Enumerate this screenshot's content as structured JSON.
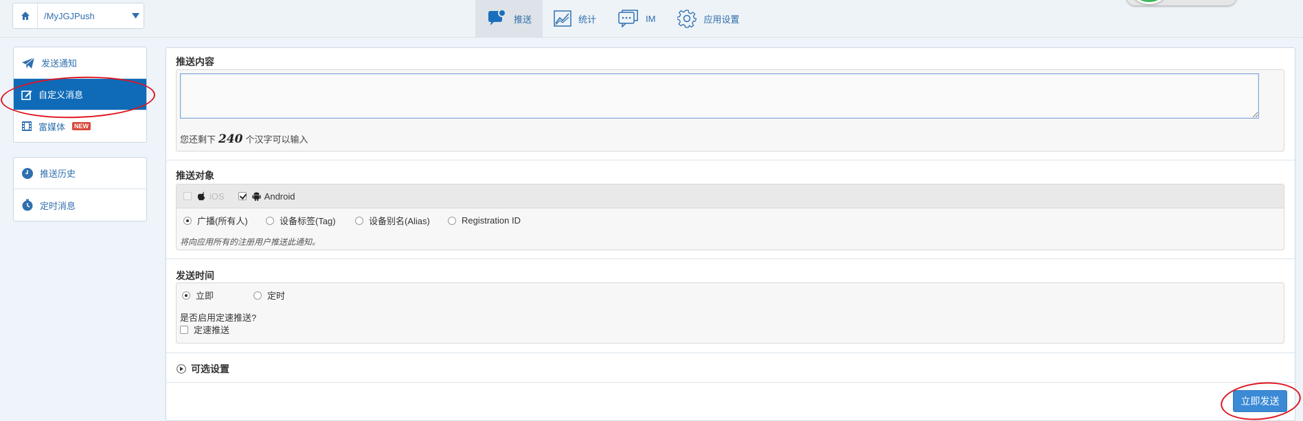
{
  "app_selector": {
    "name": "/MyJGJPush"
  },
  "topnav": [
    {
      "label": "推送",
      "icon": "chat-bubble-icon",
      "active": true
    },
    {
      "label": "统计",
      "icon": "chart-icon"
    },
    {
      "label": "IM",
      "icon": "im-icon"
    },
    {
      "label": "应用设置",
      "icon": "gear-icon"
    }
  ],
  "sidebar": {
    "group1": [
      {
        "label": "发送通知",
        "icon": "paper-plane-icon"
      },
      {
        "label": "自定义消息",
        "icon": "edit-icon",
        "active": true
      },
      {
        "label": "富媒体",
        "icon": "film-icon",
        "badge": "NEW"
      }
    ],
    "group2": [
      {
        "label": "推送历史",
        "icon": "clock-icon"
      },
      {
        "label": "定时消息",
        "icon": "timer-icon"
      }
    ]
  },
  "content": {
    "title": "推送内容",
    "textarea_value": "",
    "remaining_prefix": "您还剩下",
    "remaining_count": "240",
    "remaining_suffix": "个汉字可以输入"
  },
  "target": {
    "title": "推送对象",
    "platforms": [
      {
        "label": "iOS",
        "checked": false,
        "disabled": true
      },
      {
        "label": "Android",
        "checked": true
      }
    ],
    "audience": [
      {
        "label": "广播(所有人)",
        "checked": true
      },
      {
        "label": "设备标签(Tag)"
      },
      {
        "label": "设备别名(Alias)"
      },
      {
        "label": "Registration ID"
      }
    ],
    "hint": "将向应用所有的注册用户推送此通知。"
  },
  "time": {
    "title": "发送时间",
    "options": [
      {
        "label": "立即",
        "checked": true
      },
      {
        "label": "定时"
      }
    ],
    "rate_question": "是否启用定速推送?",
    "rate_label": "定速推送"
  },
  "optional": {
    "title": "可选设置"
  },
  "send_button": "立即发送",
  "colors": {
    "primary": "#0f6bb8",
    "link": "#2f6fae",
    "button": "#3b8ad6",
    "annotation": "#e0141e"
  }
}
